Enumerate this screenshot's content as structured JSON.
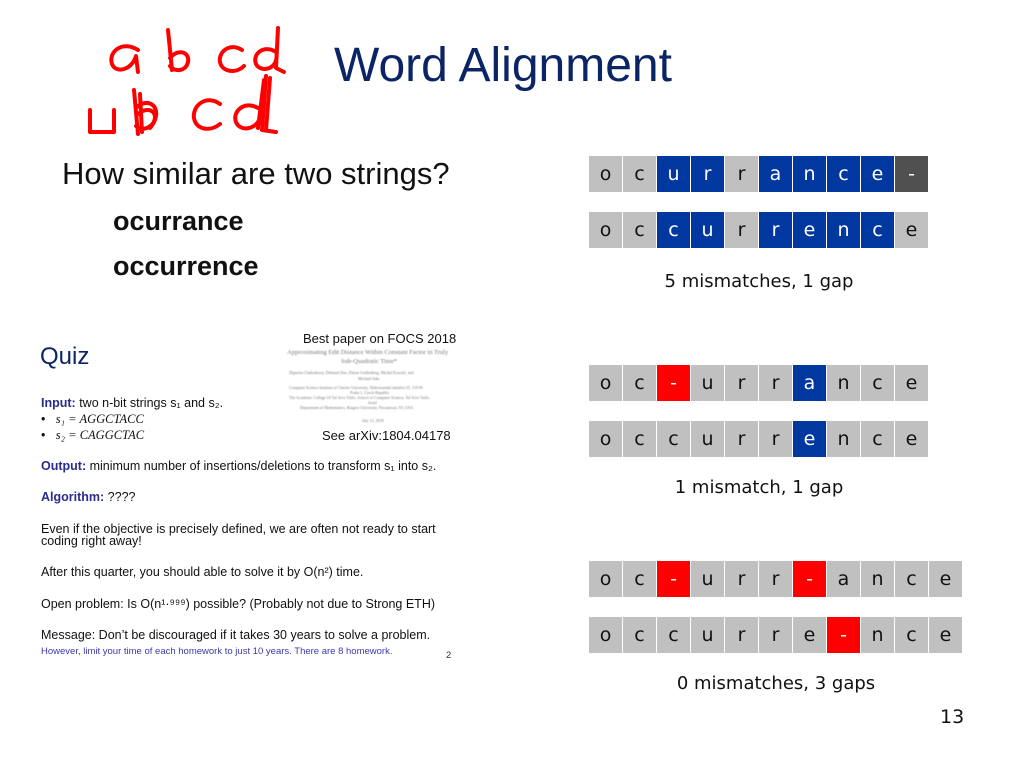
{
  "slide": {
    "title": "Word Alignment",
    "page_number": "13",
    "handwriting": {
      "line1": "a b c d",
      "line2": "u b c d (overwritten)",
      "color": "#ff0000"
    },
    "question": "How similar are two strings?",
    "words": [
      "ocurrance",
      "occurrence"
    ]
  },
  "colors": {
    "match": "#c0c0c0",
    "mismatch": "#0038a0",
    "gap": "#ff0000",
    "end_gap": "#505050",
    "title": "#0b2466"
  },
  "alignments": [
    {
      "top": [
        {
          "ch": "o",
          "kind": "match"
        },
        {
          "ch": "c",
          "kind": "match"
        },
        {
          "ch": "u",
          "kind": "mismatch"
        },
        {
          "ch": "r",
          "kind": "mismatch"
        },
        {
          "ch": "r",
          "kind": "match"
        },
        {
          "ch": "a",
          "kind": "mismatch"
        },
        {
          "ch": "n",
          "kind": "mismatch"
        },
        {
          "ch": "c",
          "kind": "mismatch"
        },
        {
          "ch": "e",
          "kind": "mismatch"
        },
        {
          "ch": "-",
          "kind": "endgap"
        }
      ],
      "bottom": [
        {
          "ch": "o",
          "kind": "match"
        },
        {
          "ch": "c",
          "kind": "match"
        },
        {
          "ch": "c",
          "kind": "mismatch"
        },
        {
          "ch": "u",
          "kind": "mismatch"
        },
        {
          "ch": "r",
          "kind": "match"
        },
        {
          "ch": "r",
          "kind": "mismatch"
        },
        {
          "ch": "e",
          "kind": "mismatch"
        },
        {
          "ch": "n",
          "kind": "mismatch"
        },
        {
          "ch": "c",
          "kind": "mismatch"
        },
        {
          "ch": "e",
          "kind": "match"
        }
      ],
      "caption": "5 mismatches, 1 gap"
    },
    {
      "top": [
        {
          "ch": "o",
          "kind": "match"
        },
        {
          "ch": "c",
          "kind": "match"
        },
        {
          "ch": "-",
          "kind": "gap"
        },
        {
          "ch": "u",
          "kind": "match"
        },
        {
          "ch": "r",
          "kind": "match"
        },
        {
          "ch": "r",
          "kind": "match"
        },
        {
          "ch": "a",
          "kind": "mismatch"
        },
        {
          "ch": "n",
          "kind": "match"
        },
        {
          "ch": "c",
          "kind": "match"
        },
        {
          "ch": "e",
          "kind": "match"
        }
      ],
      "bottom": [
        {
          "ch": "o",
          "kind": "match"
        },
        {
          "ch": "c",
          "kind": "match"
        },
        {
          "ch": "c",
          "kind": "match"
        },
        {
          "ch": "u",
          "kind": "match"
        },
        {
          "ch": "r",
          "kind": "match"
        },
        {
          "ch": "r",
          "kind": "match"
        },
        {
          "ch": "e",
          "kind": "mismatch"
        },
        {
          "ch": "n",
          "kind": "match"
        },
        {
          "ch": "c",
          "kind": "match"
        },
        {
          "ch": "e",
          "kind": "match"
        }
      ],
      "caption": "1 mismatch, 1 gap"
    },
    {
      "top": [
        {
          "ch": "o",
          "kind": "match"
        },
        {
          "ch": "c",
          "kind": "match"
        },
        {
          "ch": "-",
          "kind": "gap"
        },
        {
          "ch": "u",
          "kind": "match"
        },
        {
          "ch": "r",
          "kind": "match"
        },
        {
          "ch": "r",
          "kind": "match"
        },
        {
          "ch": "-",
          "kind": "gap"
        },
        {
          "ch": "a",
          "kind": "match"
        },
        {
          "ch": "n",
          "kind": "match"
        },
        {
          "ch": "c",
          "kind": "match"
        },
        {
          "ch": "e",
          "kind": "match"
        }
      ],
      "bottom": [
        {
          "ch": "o",
          "kind": "match"
        },
        {
          "ch": "c",
          "kind": "match"
        },
        {
          "ch": "c",
          "kind": "match"
        },
        {
          "ch": "u",
          "kind": "match"
        },
        {
          "ch": "r",
          "kind": "match"
        },
        {
          "ch": "r",
          "kind": "match"
        },
        {
          "ch": "e",
          "kind": "match"
        },
        {
          "ch": "-",
          "kind": "gap"
        },
        {
          "ch": "n",
          "kind": "match"
        },
        {
          "ch": "c",
          "kind": "match"
        },
        {
          "ch": "e",
          "kind": "match"
        }
      ],
      "caption": "0 mismatches, 3 gaps"
    }
  ],
  "quiz": {
    "title": "Quiz",
    "input_label": "Input:",
    "input_text": " two n-bit strings s₁ and s₂.",
    "bullets": [
      "s₁ = AGGCTACC",
      "s₂ = CAGGCTAC"
    ],
    "output_label": "Output:",
    "output_text": " minimum number of insertions/deletions to transform s₁ into s₂.",
    "algorithm_label": "Algorithm:",
    "algorithm_text": " ????",
    "para1_line1": "Even if the objective is precisely defined, we are often not ready to start",
    "para1_line2": "coding right away!",
    "para2": "After this quarter, you should able to solve it by O(n²) time.",
    "para3": "Open problem: Is O(n¹·⁹⁹⁹) possible? (Probably not due to Strong ETH)",
    "para4": "Message: Don’t be discouraged if it takes 30 years to solve a problem.",
    "note": "However, limit your time of each homework to just 10 years. There are 8 homework.",
    "page": "2",
    "paper": {
      "heading": "Best paper on FOCS 2018",
      "title_line1": "Approximating Edit Distance Within Constant Factor in Truly",
      "title_line2": "Sub-Quadratic Time*",
      "authors_line1": "Diptarka Chakraborty, Debarati Das, Elazar Goldenberg, Michal Koucký, and",
      "authors_line2": "Michael Saks",
      "affil1": "Computer Science Institute of Charles University, Malostranské náměstí 25, 118 00",
      "affil1b": "Praha 1, Czech Republic",
      "affil2": "The Academic College Of Tel Aviv-Yaffo, School of Computer Science, Tel Aviv-Yaffo,",
      "affil2b": "Israel",
      "affil3": "Department of Mathematics, Rutgers University, Piscataway, NJ, USA",
      "date": "July 13, 2018",
      "reference": "See arXiv:1804.04178"
    }
  }
}
